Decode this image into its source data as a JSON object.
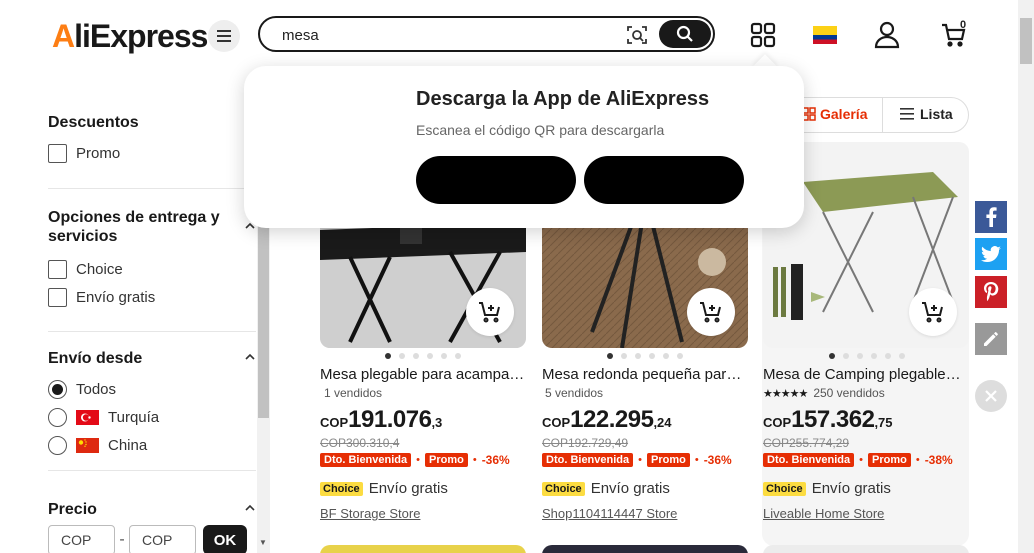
{
  "header": {
    "logo_text": "AliExpress",
    "search_value": "mesa",
    "cart_count": "0"
  },
  "popover": {
    "title": "Descarga la App de AliExpress",
    "subtitle": "Escanea el código QR para descargarla"
  },
  "sidebar": {
    "descuentos": {
      "title": "Descuentos",
      "options": [
        "Promo"
      ]
    },
    "entrega": {
      "title": "Opciones de entrega y servicios",
      "options": [
        "Choice",
        "Envío gratis"
      ]
    },
    "envio_desde": {
      "title": "Envío desde",
      "options": [
        "Todos",
        "Turquía",
        "China"
      ],
      "selected": "Todos"
    },
    "precio": {
      "title": "Precio",
      "min_placeholder": "COP",
      "max_placeholder": "COP",
      "dash": "-",
      "ok_label": "OK"
    }
  },
  "view": {
    "galeria": "Galería",
    "lista": "Lista"
  },
  "products": [
    {
      "title": "Mesa plegable para acampar al aire libre",
      "sold": "1 vendidos",
      "cur": "COP",
      "price_int": "191.076",
      "price_dec": ",3",
      "old_price": "COP300.310,4",
      "badge1": "Dto. Bienvenida",
      "badge2": "Promo",
      "discount": "-36%",
      "choice": "Choice",
      "ship": "Envío gratis",
      "store": "BF Storage Store"
    },
    {
      "title": "Mesa redonda pequeña para acampar",
      "sold": "5 vendidos",
      "cur": "COP",
      "price_int": "122.295",
      "price_dec": ",24",
      "old_price": "COP192.729,49",
      "badge1": "Dto. Bienvenida",
      "badge2": "Promo",
      "discount": "-36%",
      "choice": "Choice",
      "ship": "Envío gratis",
      "store": "Shop1104114447 Store"
    },
    {
      "title": "Mesa de Camping plegable portátil",
      "sold": "250 vendidos",
      "stars": "★★★★★",
      "cur": "COP",
      "price_int": "157.362",
      "price_dec": ",75",
      "old_price": "COP255.774,29",
      "badge1": "Dto. Bienvenida",
      "badge2": "Promo",
      "discount": "-38%",
      "choice": "Choice",
      "ship": "Envío gratis",
      "store": "Liveable Home Store"
    }
  ],
  "colors": {
    "accent": "#e62e04",
    "choice": "#fcdc41",
    "facebook": "#3b5998",
    "twitter": "#1da1f2",
    "pinterest": "#cb2027"
  }
}
